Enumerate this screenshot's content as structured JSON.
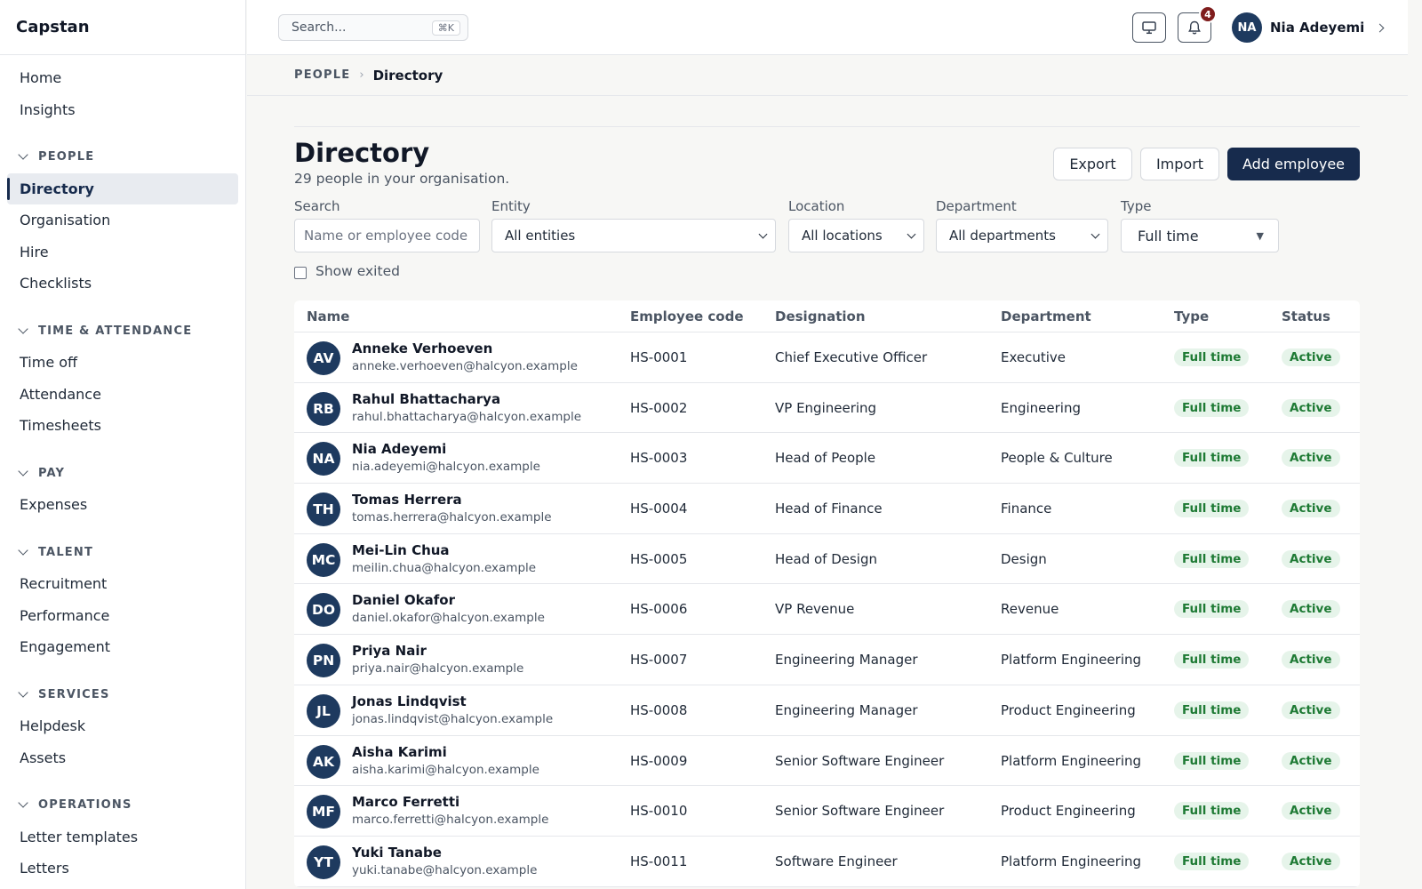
{
  "app": {
    "name": "Capstan"
  },
  "sidebar": {
    "top_items": [
      "Home",
      "Insights"
    ],
    "sections": [
      {
        "label": "PEOPLE",
        "items": [
          "Directory",
          "Organisation",
          "Hire",
          "Checklists"
        ],
        "active": "Directory"
      },
      {
        "label": "TIME & ATTENDANCE",
        "items": [
          "Time off",
          "Attendance",
          "Timesheets"
        ]
      },
      {
        "label": "PAY",
        "items": [
          "Expenses"
        ]
      },
      {
        "label": "TALENT",
        "items": [
          "Recruitment",
          "Performance",
          "Engagement"
        ]
      },
      {
        "label": "SERVICES",
        "items": [
          "Helpdesk",
          "Assets"
        ]
      },
      {
        "label": "OPERATIONS",
        "items": [
          "Letter templates",
          "Letters"
        ]
      }
    ]
  },
  "topbar": {
    "search_placeholder": "Search...",
    "search_shortcut": "⌘K",
    "notification_count": "4",
    "user": {
      "initials": "NA",
      "name": "Nia Adeyemi"
    },
    "icons": [
      "monitor-icon",
      "bell-icon",
      "chevron-right-icon"
    ]
  },
  "breadcrumb": {
    "root": "PEOPLE",
    "current": "Directory"
  },
  "page": {
    "title": "Directory",
    "subtitle": "29 people in your organisation.",
    "export_label": "Export",
    "import_label": "Import",
    "add_label": "Add employee"
  },
  "filters": {
    "search": {
      "label": "Search",
      "placeholder": "Name or employee code"
    },
    "entity": {
      "label": "Entity",
      "value": "All entities"
    },
    "location": {
      "label": "Location",
      "value": "All locations"
    },
    "department": {
      "label": "Department",
      "value": "All departments"
    },
    "type": {
      "label": "Type",
      "value": "Full time"
    },
    "show_exited": {
      "label": "Show exited",
      "checked": false
    }
  },
  "table": {
    "columns": [
      "Name",
      "Employee code",
      "Designation",
      "Department",
      "Type",
      "Status"
    ],
    "rows": [
      {
        "initials": "AV",
        "name": "Anneke Verhoeven",
        "email": "anneke.verhoeven@halcyon.example",
        "code": "HS-0001",
        "designation": "Chief Executive Officer",
        "department": "Executive",
        "type": "Full time",
        "status": "Active"
      },
      {
        "initials": "RB",
        "name": "Rahul Bhattacharya",
        "email": "rahul.bhattacharya@halcyon.example",
        "code": "HS-0002",
        "designation": "VP Engineering",
        "department": "Engineering",
        "type": "Full time",
        "status": "Active"
      },
      {
        "initials": "NA",
        "name": "Nia Adeyemi",
        "email": "nia.adeyemi@halcyon.example",
        "code": "HS-0003",
        "designation": "Head of People",
        "department": "People & Culture",
        "type": "Full time",
        "status": "Active"
      },
      {
        "initials": "TH",
        "name": "Tomas Herrera",
        "email": "tomas.herrera@halcyon.example",
        "code": "HS-0004",
        "designation": "Head of Finance",
        "department": "Finance",
        "type": "Full time",
        "status": "Active"
      },
      {
        "initials": "MC",
        "name": "Mei-Lin Chua",
        "email": "meilin.chua@halcyon.example",
        "code": "HS-0005",
        "designation": "Head of Design",
        "department": "Design",
        "type": "Full time",
        "status": "Active"
      },
      {
        "initials": "DO",
        "name": "Daniel Okafor",
        "email": "daniel.okafor@halcyon.example",
        "code": "HS-0006",
        "designation": "VP Revenue",
        "department": "Revenue",
        "type": "Full time",
        "status": "Active"
      },
      {
        "initials": "PN",
        "name": "Priya Nair",
        "email": "priya.nair@halcyon.example",
        "code": "HS-0007",
        "designation": "Engineering Manager",
        "department": "Platform Engineering",
        "type": "Full time",
        "status": "Active"
      },
      {
        "initials": "JL",
        "name": "Jonas Lindqvist",
        "email": "jonas.lindqvist@halcyon.example",
        "code": "HS-0008",
        "designation": "Engineering Manager",
        "department": "Product Engineering",
        "type": "Full time",
        "status": "Active"
      },
      {
        "initials": "AK",
        "name": "Aisha Karimi",
        "email": "aisha.karimi@halcyon.example",
        "code": "HS-0009",
        "designation": "Senior Software Engineer",
        "department": "Platform Engineering",
        "type": "Full time",
        "status": "Active"
      },
      {
        "initials": "MF",
        "name": "Marco Ferretti",
        "email": "marco.ferretti@halcyon.example",
        "code": "HS-0010",
        "designation": "Senior Software Engineer",
        "department": "Product Engineering",
        "type": "Full time",
        "status": "Active"
      },
      {
        "initials": "YT",
        "name": "Yuki Tanabe",
        "email": "yuki.tanabe@halcyon.example",
        "code": "HS-0011",
        "designation": "Software Engineer",
        "department": "Platform Engineering",
        "type": "Full time",
        "status": "Active"
      }
    ]
  },
  "colors": {
    "primary": "#172b4d",
    "avatar": "#1e3a5f",
    "badge": "#7f1d1d",
    "pill_bg": "#e6f4ea",
    "pill_text": "#1e7a34"
  }
}
